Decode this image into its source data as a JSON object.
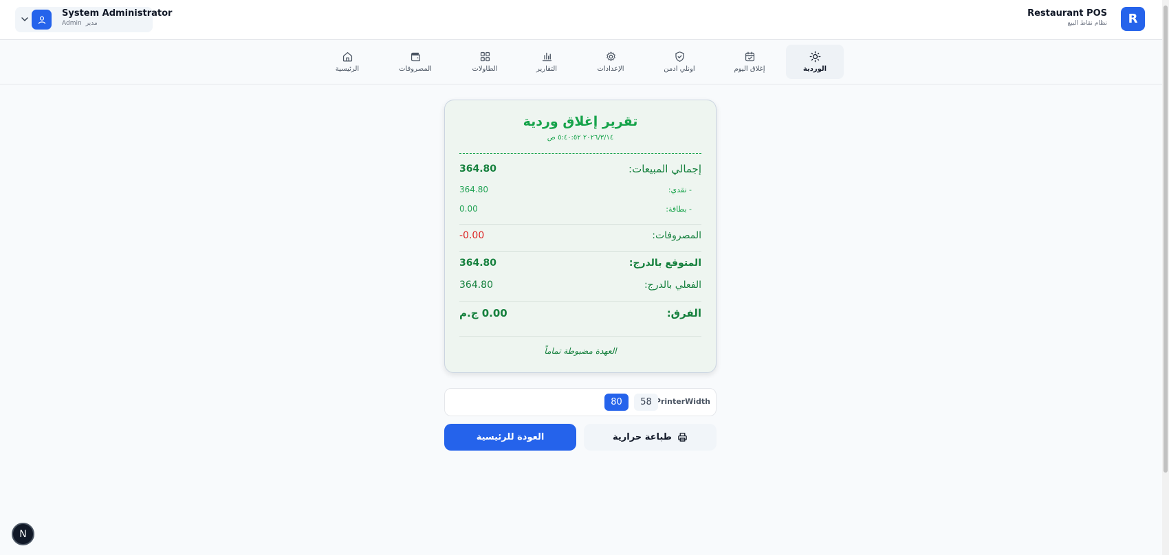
{
  "header": {
    "user_name": "System Administrator",
    "user_role_en": "Admin",
    "user_role_ar": "مدير",
    "brand_logo_letter": "R",
    "brand_name": "Restaurant POS",
    "brand_subtitle": "نظام نقاط البيع"
  },
  "nav": {
    "items": [
      {
        "label": "الوردية",
        "icon": "sun-icon",
        "active": true
      },
      {
        "label": "إغلاق اليوم",
        "icon": "calendar-check-icon"
      },
      {
        "label": "اونلي ادمن",
        "icon": "shield-check-icon"
      },
      {
        "label": "الإعدادات",
        "icon": "gear-icon"
      },
      {
        "label": "التقارير",
        "icon": "bar-chart-icon"
      },
      {
        "label": "الطاولات",
        "icon": "grid-icon"
      },
      {
        "label": "المصروفات",
        "icon": "wallet-icon"
      },
      {
        "label": "الرئيسية",
        "icon": "home-icon"
      }
    ]
  },
  "report": {
    "title": "تقرير إغلاق وردية",
    "datetime": "٢٠٢٦/٣/١٤ ٥:٤٠:٥٢ ص",
    "total_sales_label": "إجمالي المبيعات:",
    "total_sales_value": "364.80",
    "cash_label": "- نقدي:",
    "cash_value": "364.80",
    "card_label": "- بطاقة:",
    "card_value": "0.00",
    "expenses_label": "المصروفات:",
    "expenses_value": "-0.00",
    "expected_label": "المتوقع بالدرج:",
    "expected_value": "364.80",
    "actual_label": "الفعلي بالدرج:",
    "actual_value": "364.80",
    "difference_label": "الفرق:",
    "difference_value": "0.00 ج.م",
    "note": "العهدة مضبوطة تماماً"
  },
  "printer": {
    "label": "PrinterWidth",
    "options": [
      "58",
      "80"
    ],
    "selected": "80"
  },
  "actions": {
    "print_label": "طباعة حرارية",
    "home_label": "العودة للرئيسية"
  },
  "badge": {
    "letter": "N"
  },
  "colors": {
    "accent": "#2563eb",
    "success": "#16a34a",
    "danger": "#dc2626"
  }
}
